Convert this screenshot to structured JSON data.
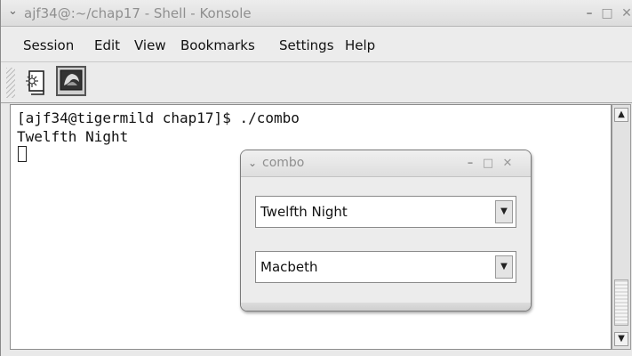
{
  "window": {
    "title": "ajf34@:~/chap17 - Shell - Konsole",
    "menu_glyph": "⌄",
    "minimize_glyph": "–",
    "maximize_glyph": "□",
    "close_glyph": "✕"
  },
  "menubar": {
    "items": [
      "Session",
      "Edit",
      "View",
      "Bookmarks",
      "Settings",
      "Help"
    ]
  },
  "toolbar": {
    "icons": [
      "new-session-icon",
      "konsole-shell-icon"
    ]
  },
  "terminal": {
    "lines": [
      "[ajf34@tigermild chap17]$ ./combo",
      "Twelfth Night"
    ]
  },
  "scrollbar": {
    "up_glyph": "▲",
    "down_glyph": "▼"
  },
  "combo_dialog": {
    "title": "combo",
    "menu_glyph": "⌄",
    "minimize_glyph": "–",
    "maximize_glyph": "□",
    "close_glyph": "✕",
    "select_1": {
      "value": "Twelfth Night",
      "arrow": "▼"
    },
    "select_2": {
      "value": "Macbeth",
      "arrow": "▼"
    }
  }
}
